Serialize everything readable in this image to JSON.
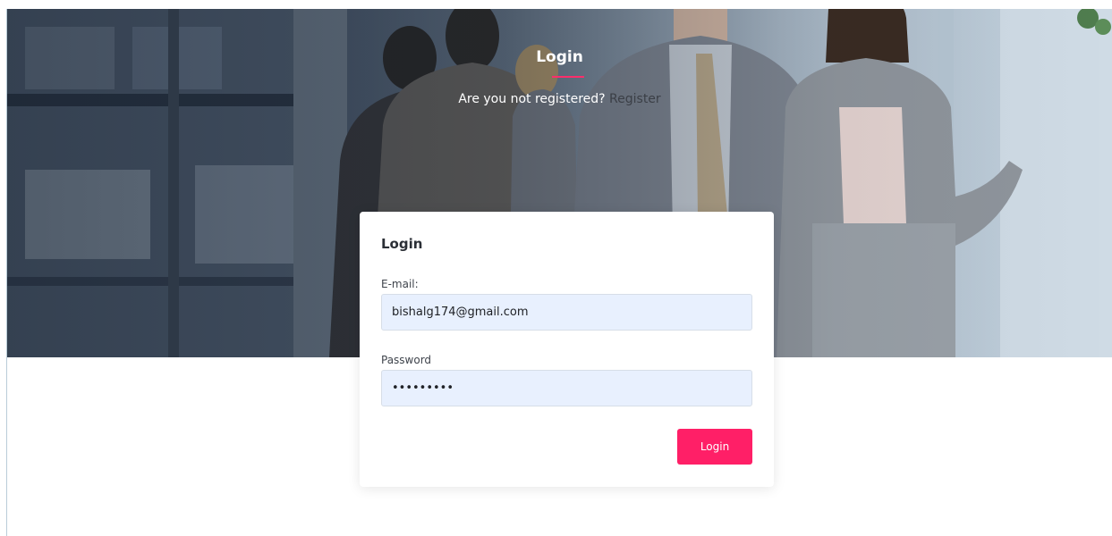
{
  "hero": {
    "title": "Login",
    "subtitle_prefix": "Are you not registered?",
    "register_link": "Register"
  },
  "form": {
    "title": "Login",
    "email_label": "E-mail:",
    "email_value": "bishalg174@gmail.com",
    "password_label": "Password",
    "password_value": "123456789",
    "submit_label": "Login"
  },
  "colors": {
    "accent": "#ff1f67",
    "input_bg": "#e8f0fe"
  }
}
